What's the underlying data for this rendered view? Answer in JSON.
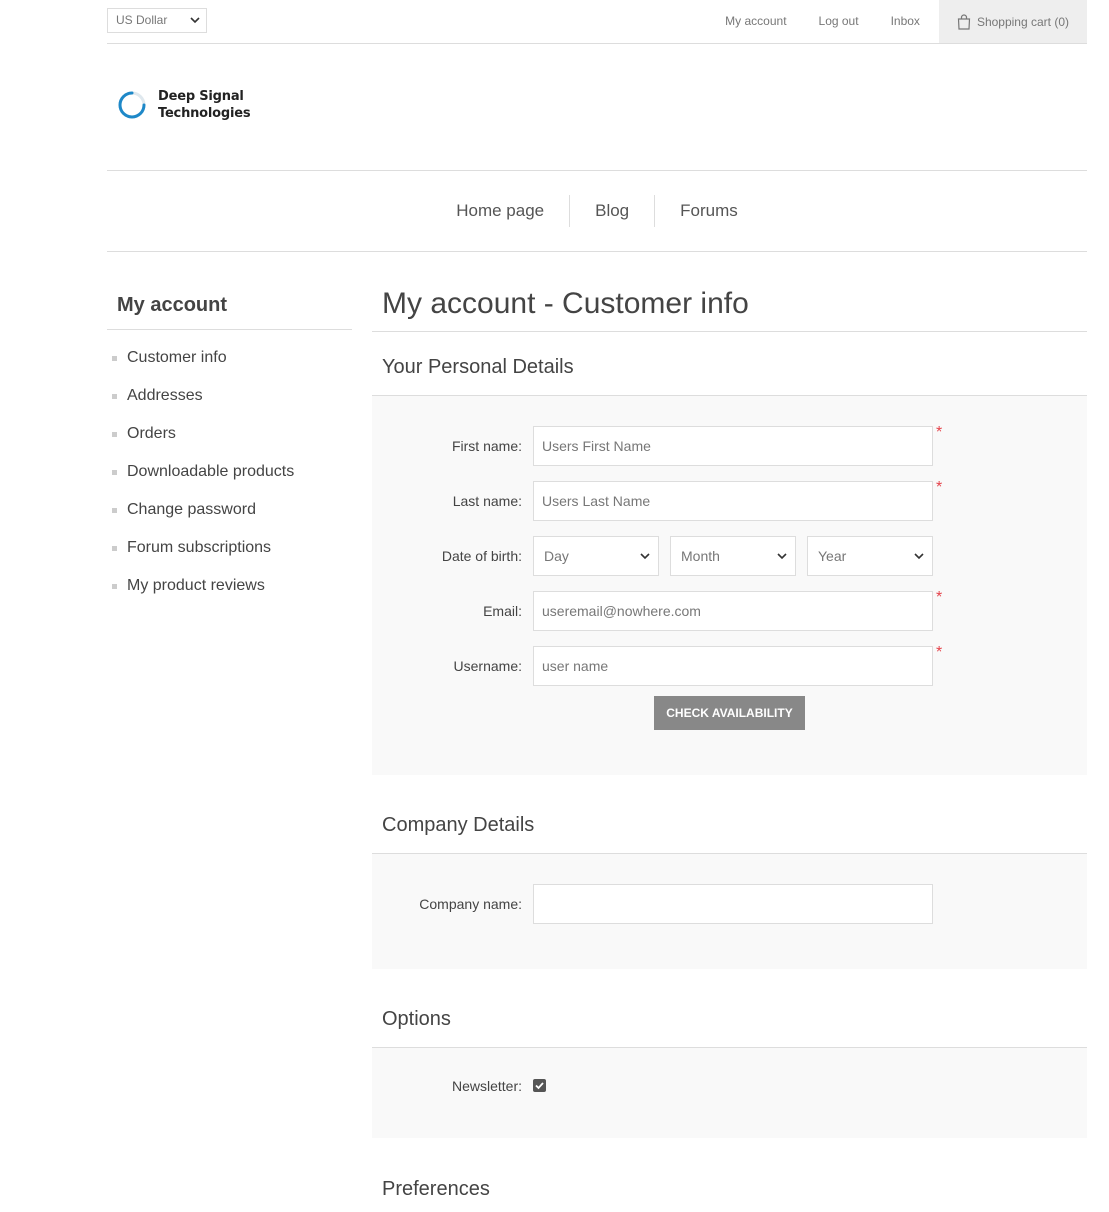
{
  "header": {
    "currency": "US Dollar",
    "links": [
      "My account",
      "Log out",
      "Inbox"
    ],
    "cart": "Shopping cart (0)"
  },
  "logo": {
    "line1": "Deep Signal",
    "line2": "Technologies"
  },
  "menu": [
    "Home page",
    "Blog",
    "Forums"
  ],
  "sidebar": {
    "title": "My account",
    "items": [
      "Customer info",
      "Addresses",
      "Orders",
      "Downloadable products",
      "Change password",
      "Forum subscriptions",
      "My product reviews"
    ]
  },
  "page": {
    "title": "My account - Customer info"
  },
  "personal": {
    "title": "Your Personal Details",
    "first_name_label": "First name:",
    "first_name_value": "Users First Name",
    "last_name_label": "Last name:",
    "last_name_value": "Users Last Name",
    "dob_label": "Date of birth:",
    "dob_day": "Day",
    "dob_month": "Month",
    "dob_year": "Year",
    "email_label": "Email:",
    "email_value": "useremail@nowhere.com",
    "username_label": "Username:",
    "username_value": "user name",
    "check_button": "CHECK AVAILABILITY",
    "required_mark": "*"
  },
  "company": {
    "title": "Company Details",
    "name_label": "Company name:",
    "name_value": ""
  },
  "options": {
    "title": "Options",
    "newsletter_label": "Newsletter:",
    "newsletter_checked": true
  },
  "preferences": {
    "title": "Preferences"
  },
  "colors": {
    "required": "#e4434b",
    "button": "#888888"
  }
}
